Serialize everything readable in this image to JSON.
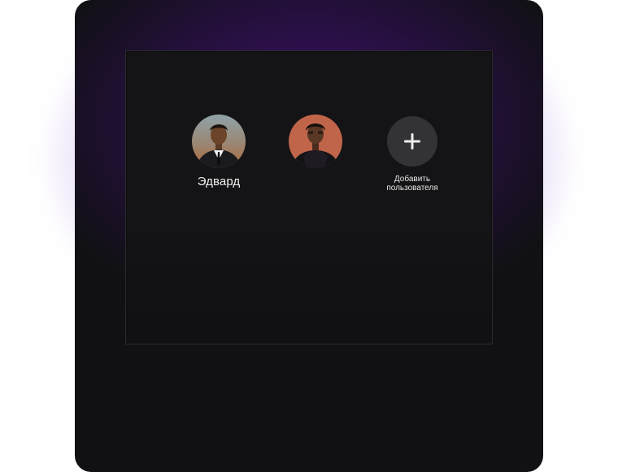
{
  "profiles": [
    {
      "name": "Эдвард",
      "avatar_icon": "avatar-man-in-suit"
    },
    {
      "name": "",
      "avatar_icon": "avatar-person-orange-background"
    }
  ],
  "add_user": {
    "label": "Добавить пользователя",
    "icon": "plus-icon"
  },
  "colors": {
    "device_background": "#111114",
    "glow": "#6a1fb8",
    "add_circle": "#333336",
    "text": "#f2f2f2"
  }
}
